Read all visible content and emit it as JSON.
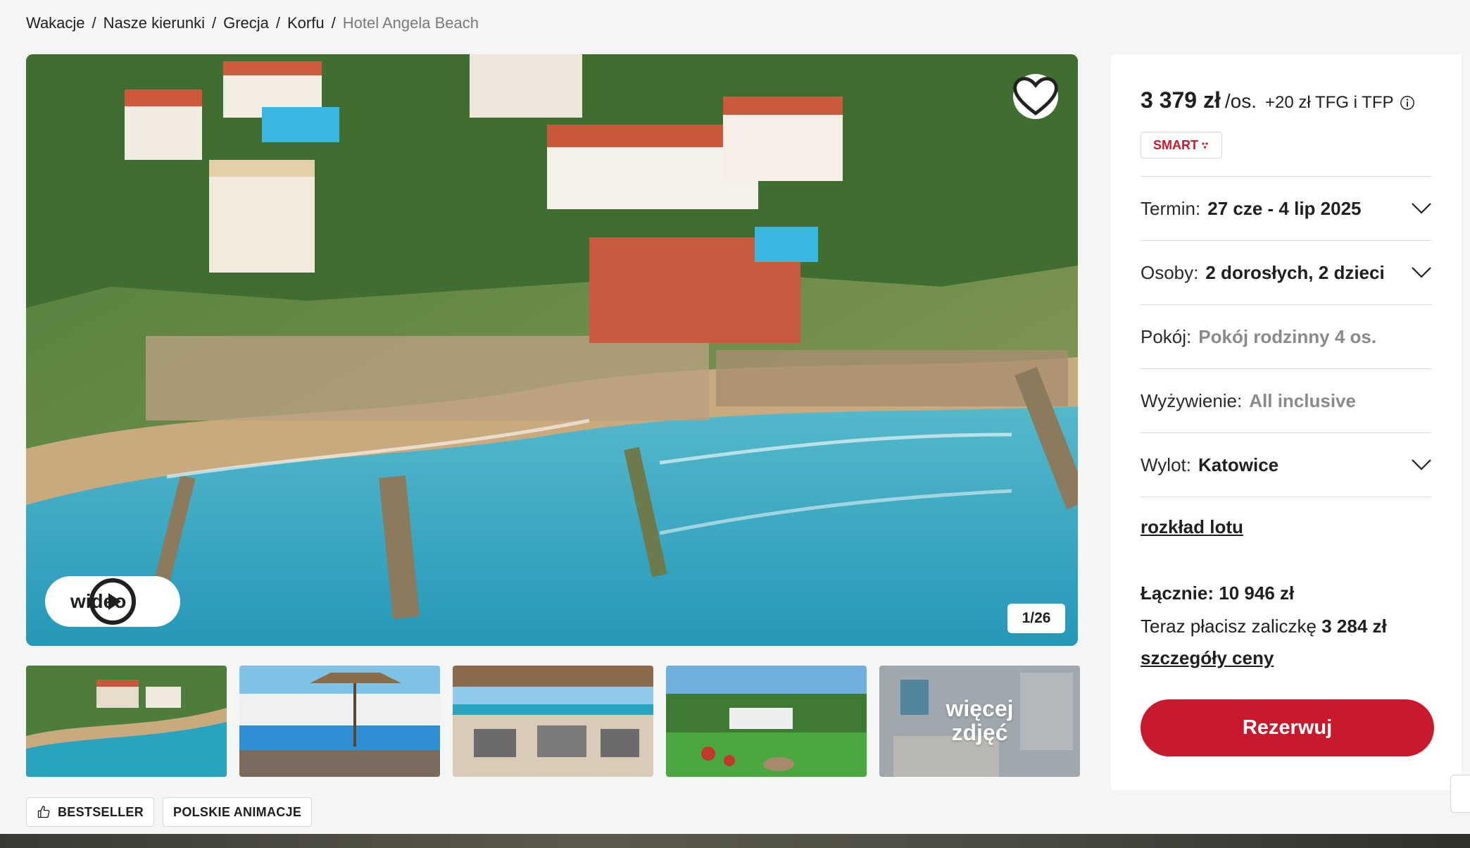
{
  "breadcrumb": {
    "items": [
      "Wakacje",
      "Nasze kierunki",
      "Grecja",
      "Korfu"
    ],
    "current": "Hotel Angela Beach",
    "separator": "/"
  },
  "gallery": {
    "video_label": "wideo",
    "counter": "1/26",
    "more_label": "więcej zdjęć",
    "thumbnails": [
      "aerial-resort",
      "pool-umbrellas",
      "restaurant-terrace",
      "garden-lawn",
      "hotel-room"
    ]
  },
  "tags": [
    {
      "label": "BESTSELLER",
      "icon": "thumbs-up-icon"
    },
    {
      "label": "POLSKIE ANIMACJE"
    }
  ],
  "booking": {
    "price_value": "3 379 zł",
    "per_person": "/os.",
    "price_extra": "+20 zł TFG i TFP",
    "badge": "SMART",
    "fields": [
      {
        "label": "Termin:",
        "value": "27 cze - 4 lip 2025",
        "muted": false,
        "dropdown": true
      },
      {
        "label": "Osoby:",
        "value": "2 dorosłych, 2 dzieci",
        "muted": false,
        "dropdown": true
      },
      {
        "label": "Pokój:",
        "value": "Pokój rodzinny 4 os.",
        "muted": true,
        "dropdown": false
      },
      {
        "label": "Wyżywienie:",
        "value": "All inclusive",
        "muted": true,
        "dropdown": false
      },
      {
        "label": "Wylot:",
        "value": "Katowice",
        "muted": false,
        "dropdown": true
      }
    ],
    "flight_schedule_link": "rozkład lotu",
    "total": "Łącznie: 10 946 zł",
    "deposit_text": "Teraz płacisz zaliczkę",
    "deposit_value": "3 284 zł",
    "price_details_link": "szczegóły ceny",
    "reserve_label": "Rezerwuj"
  },
  "colors": {
    "accent": "#c8192d",
    "sea": "#2aa3bf",
    "background": "#f5f5f5"
  }
}
